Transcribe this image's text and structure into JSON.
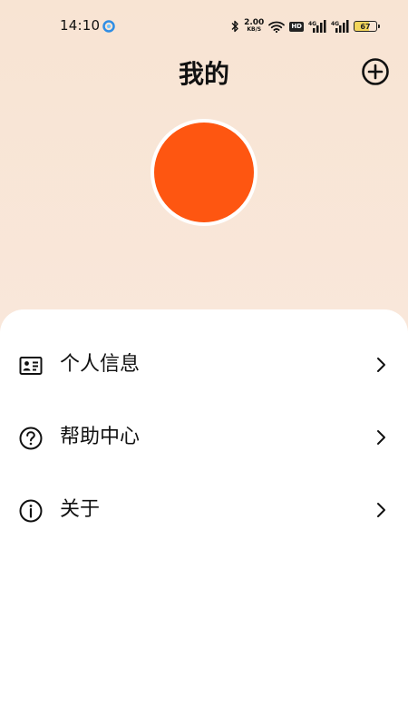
{
  "status_bar": {
    "time": "14:10",
    "net_speed_value": "2.00",
    "net_speed_unit": "KB/S",
    "hd_label": "HD",
    "signal_1_label": "4G",
    "signal_2_label": "4G",
    "battery_level": "67"
  },
  "header": {
    "title": "我的",
    "add_icon": "plus-circle-icon"
  },
  "avatar": {
    "color": "#fe5611"
  },
  "menu": {
    "items": [
      {
        "label": "个人信息",
        "icon": "id-card-icon"
      },
      {
        "label": "帮助中心",
        "icon": "question-circle-icon"
      },
      {
        "label": "关于",
        "icon": "info-circle-icon"
      }
    ]
  },
  "colors": {
    "background_top": "#f8e4d3",
    "sheet": "#ffffff",
    "text": "#111111",
    "accent": "#fe5611"
  }
}
